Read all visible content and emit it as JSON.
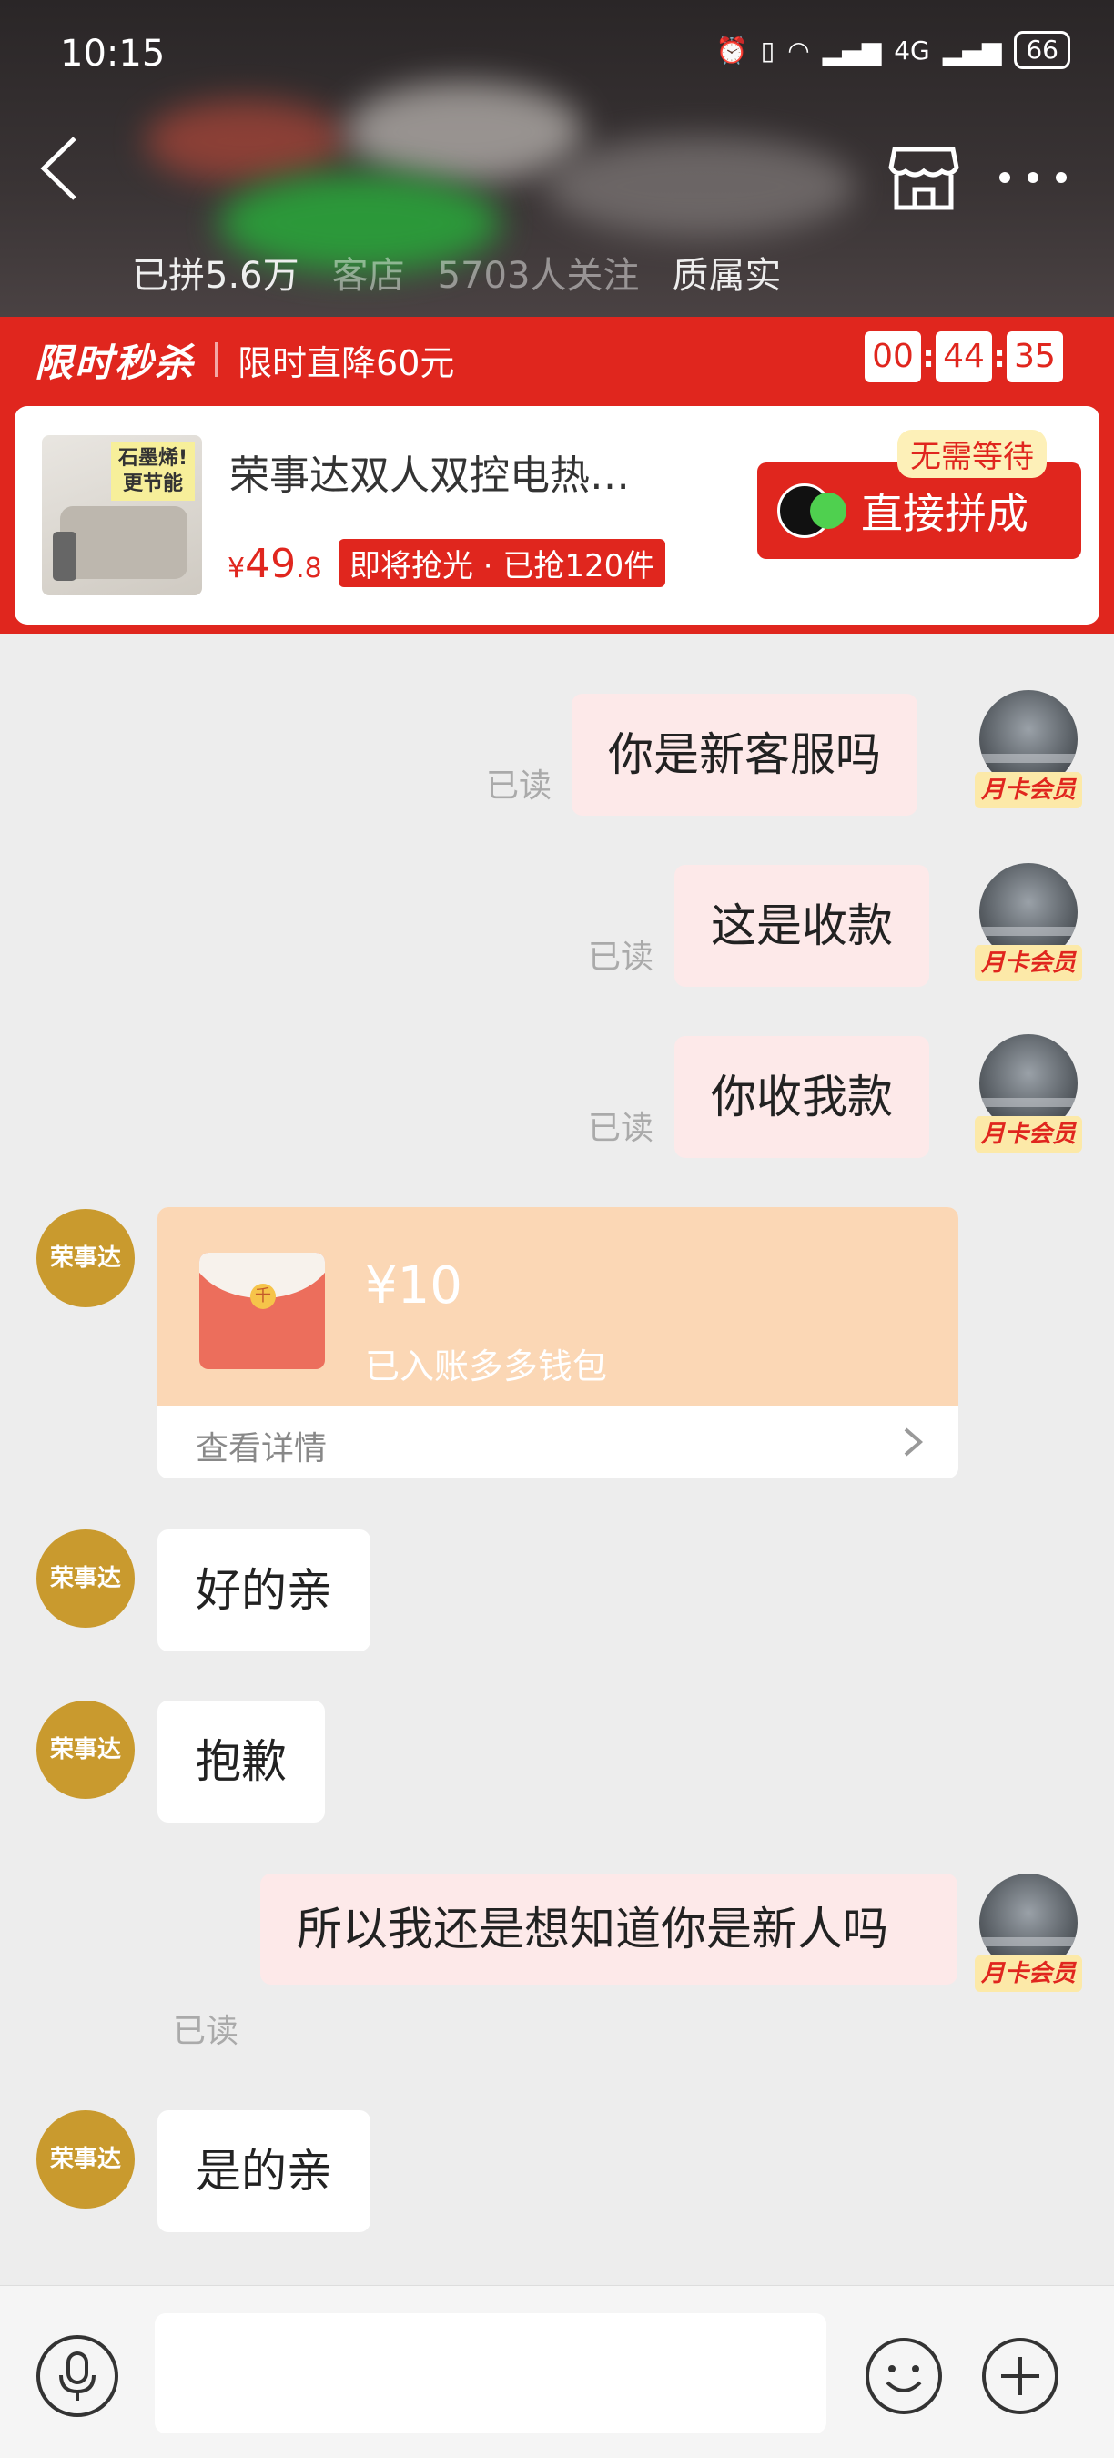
{
  "status_bar": {
    "time": "10:15",
    "battery": "66",
    "network": "4G"
  },
  "header": {
    "stats": [
      "已拼5.6万",
      "客店",
      "5703人关注",
      "质属实"
    ]
  },
  "flash_sale": {
    "title": "限时秒杀",
    "subtitle": "限时直降60元",
    "countdown": [
      "00",
      "44",
      "35"
    ],
    "product": {
      "name": "荣事达双人双控电热…",
      "price_symbol": "¥",
      "price_main": "49",
      "price_decimal": ".8",
      "badge": "即将抢光 · 已抢120件",
      "image_tag_line1": "石墨烯!",
      "image_tag_line2": "更节能"
    },
    "no_wait_label": "无需等待",
    "buy_button_label": "直接拼成"
  },
  "chat": {
    "member_tag": "月卡会员",
    "shop_avatar_label": "荣事达",
    "read_label": "已读",
    "messages": [
      {
        "from": "me",
        "text": "你是新客服吗"
      },
      {
        "from": "me",
        "text": "这是收款"
      },
      {
        "from": "me",
        "text": "你收我款"
      },
      {
        "from": "shop",
        "type": "redpacket"
      },
      {
        "from": "shop",
        "text": "好的亲"
      },
      {
        "from": "shop",
        "text": "抱歉"
      },
      {
        "from": "me",
        "text": "所以我还是想知道你是新人吗"
      },
      {
        "from": "shop",
        "text": "是的亲"
      }
    ],
    "redpacket": {
      "amount": "¥10",
      "desc": "已入账多多钱包",
      "detail_label": "查看详情"
    }
  },
  "input_bar": {
    "placeholder": "",
    "icons": [
      "microphone-icon",
      "emoji-icon",
      "plus-icon"
    ]
  },
  "colors": {
    "brand_red": "#e0261e",
    "my_bubble": "#fde9e9",
    "shop_avatar": "#c99a2e"
  }
}
